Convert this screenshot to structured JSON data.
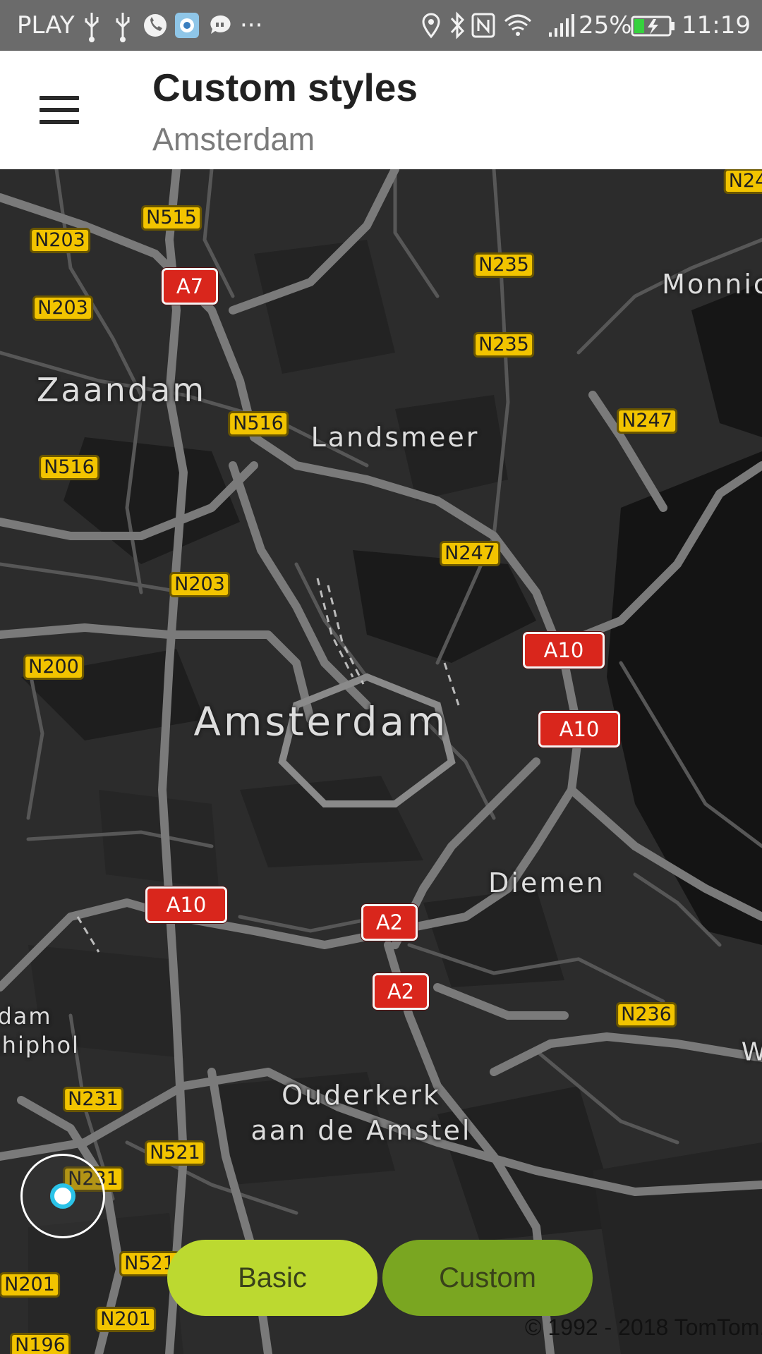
{
  "status_bar": {
    "carrier": "PLAY",
    "overflow": "···",
    "battery_percent": "25%",
    "time": "11:19",
    "icons": [
      "usb-icon",
      "usb-icon",
      "phone-icon",
      "app-icon",
      "chat-icon",
      "location-icon",
      "bluetooth-icon",
      "nfc-icon",
      "wifi-icon",
      "signal-icon",
      "battery-charging-icon"
    ]
  },
  "header": {
    "title": "Custom styles",
    "subtitle": "Amsterdam",
    "menu_icon": "hamburger-menu-icon"
  },
  "map": {
    "places": {
      "zaandam": "Zaandam",
      "landsmeer": "Landsmeer",
      "monnic": "Monnic",
      "amsterdam": "Amsterdam",
      "diemen": "Diemen",
      "ouderkerk_1": "Ouderkerk",
      "ouderkerk_2": "aan de Amstel",
      "dam": "dam",
      "schiphol": "chiphol",
      "w": "W"
    },
    "road_labels": {
      "n515": "N515",
      "n203_a": "N203",
      "n203_b": "N203",
      "n203_c": "N203",
      "n235_a": "N235",
      "n235_b": "N235",
      "n516_a": "N516",
      "n516_b": "N516",
      "n247_a": "N247",
      "n247_b": "N247",
      "n200": "N200",
      "n236": "N236",
      "n231_a": "N231",
      "n231_b": "N231",
      "n521_a": "N521",
      "n521_b": "N521",
      "n201_a": "N201",
      "n201_b": "N201",
      "n196": "N196",
      "n24": "N24",
      "a7": "A7",
      "a10_a": "A10",
      "a10_b": "A10",
      "a10_c": "A10",
      "a2_a": "A2",
      "a2_b": "A2"
    },
    "location_icon": "my-location-icon"
  },
  "style_buttons": {
    "basic": "Basic",
    "custom": "Custom"
  },
  "copyright": "© 1992 - 2018 TomTom.",
  "colors": {
    "map_background": "#2c2c2c",
    "road": "#6a6a6a",
    "water": "#121212",
    "n_shield": "#f2c400",
    "a_shield": "#d9261c",
    "basic_button": "#bcd930",
    "custom_button": "#7aa621",
    "location_dot": "#2bc3e8"
  }
}
